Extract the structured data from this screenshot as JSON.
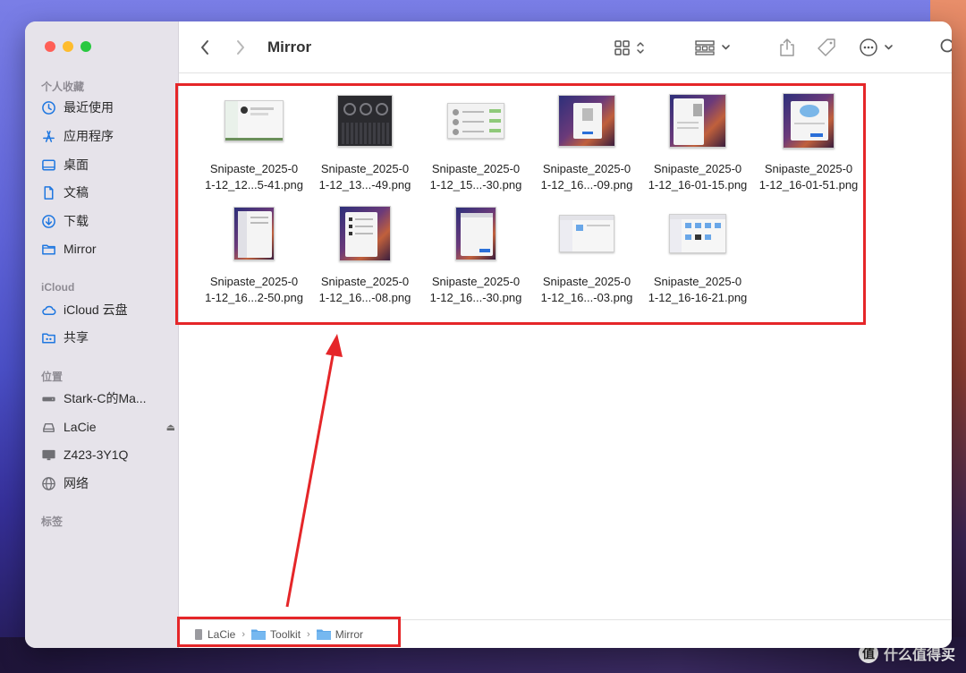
{
  "window": {
    "title": "Mirror"
  },
  "sidebar": {
    "sections": [
      {
        "header": "个人收藏",
        "items": [
          {
            "label": "最近使用",
            "icon": "clock-icon"
          },
          {
            "label": "应用程序",
            "icon": "apps-icon"
          },
          {
            "label": "桌面",
            "icon": "desktop-icon"
          },
          {
            "label": "文稿",
            "icon": "document-icon"
          },
          {
            "label": "下载",
            "icon": "download-icon"
          },
          {
            "label": "Mirror",
            "icon": "folder-icon"
          }
        ]
      },
      {
        "header": "iCloud",
        "items": [
          {
            "label": "iCloud 云盘",
            "icon": "cloud-icon"
          },
          {
            "label": "共享",
            "icon": "shared-folder-icon"
          }
        ]
      },
      {
        "header": "位置",
        "items": [
          {
            "label": "Stark-C的Ma...",
            "icon": "mac-mini-icon"
          },
          {
            "label": "LaCie",
            "icon": "drive-icon",
            "eject": "⏏"
          },
          {
            "label": "Z423-3Y1Q",
            "icon": "monitor-icon"
          },
          {
            "label": "网络",
            "icon": "network-icon"
          }
        ]
      },
      {
        "header": "标签",
        "items": []
      }
    ]
  },
  "toolbar": {
    "back_icon": "chevron-left-icon",
    "forward_icon": "chevron-right-icon",
    "view_icon": "grid-view-icon",
    "group_icon": "group-icon",
    "share_icon": "share-icon",
    "tag_icon": "tag-icon",
    "more_icon": "ellipsis-icon",
    "search_icon": "search-icon"
  },
  "files": [
    {
      "name": "Snipaste_2025-0\n1-12_12...5-41.png",
      "thumb": "light-window"
    },
    {
      "name": "Snipaste_2025-0\n1-12_13...-49.png",
      "thumb": "dark-dashboard"
    },
    {
      "name": "Snipaste_2025-0\n1-12_15...-30.png",
      "thumb": "light-list"
    },
    {
      "name": "Snipaste_2025-0\n1-12_16...-09.png",
      "thumb": "wallpaper-dialog"
    },
    {
      "name": "Snipaste_2025-0\n1-12_16-01-15.png",
      "thumb": "wallpaper-dialog"
    },
    {
      "name": "Snipaste_2025-0\n1-12_16-01-51.png",
      "thumb": "wallpaper-setup"
    },
    {
      "name": "Snipaste_2025-0\n1-12_16...2-50.png",
      "thumb": "wallpaper-list"
    },
    {
      "name": "Snipaste_2025-0\n1-12_16...-08.png",
      "thumb": "wallpaper-list"
    },
    {
      "name": "Snipaste_2025-0\n1-12_16...-30.png",
      "thumb": "wallpaper-list"
    },
    {
      "name": "Snipaste_2025-0\n1-12_16...-03.png",
      "thumb": "finder-window"
    },
    {
      "name": "Snipaste_2025-0\n1-12_16-16-21.png",
      "thumb": "finder-icons"
    }
  ],
  "path_bar": [
    {
      "label": "LaCie",
      "icon": "drive-icon"
    },
    {
      "label": "Toolkit",
      "icon": "folder-icon"
    },
    {
      "label": "Mirror",
      "icon": "folder-icon"
    }
  ],
  "watermark": {
    "badge": "值",
    "text": "什么值得买"
  },
  "colors": {
    "annotation": "#e52629",
    "accent": "#1f77e0",
    "sidebar_bg": "#e6e3ea"
  }
}
